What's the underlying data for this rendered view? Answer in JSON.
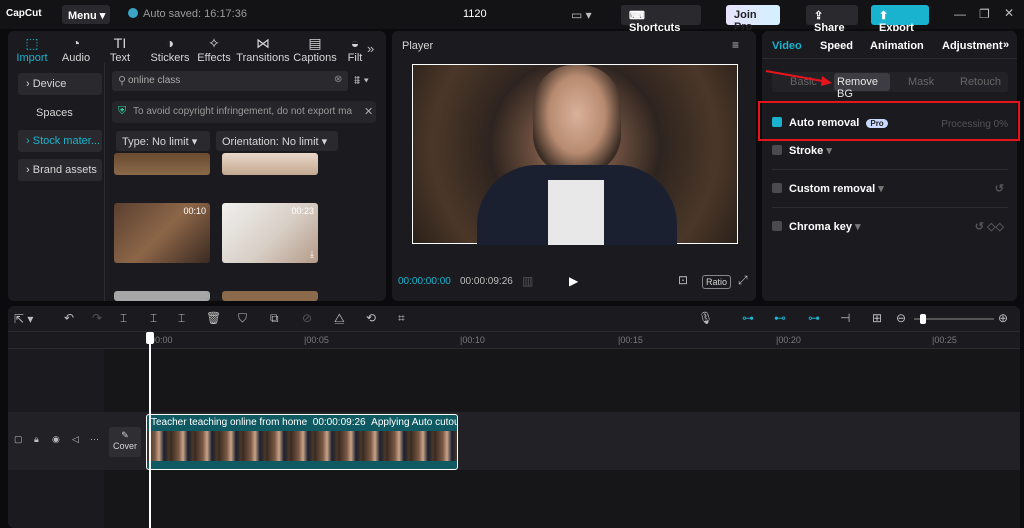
{
  "topbar": {
    "logo": "CapCut",
    "menu": "Menu",
    "autosave": "Auto saved: 16:17:36",
    "project": "1120",
    "shortcuts": "Shortcuts",
    "join_pro": "Join Pro",
    "share": "Share",
    "export": "Export"
  },
  "media_tabs": [
    "Import",
    "Audio",
    "Text",
    "Stickers",
    "Effects",
    "Transitions",
    "Captions",
    "Filt"
  ],
  "media_sidebar": [
    "Device",
    "Spaces",
    "Stock mater...",
    "Brand assets"
  ],
  "search": {
    "placeholder": "online class"
  },
  "notice": "To avoid copyright infringement, do not export ma",
  "filters": {
    "type": "Type: No limit",
    "orientation": "Orientation: No limit"
  },
  "thumbs": [
    "00:10",
    "00:23",
    "",
    ""
  ],
  "player": {
    "title": "Player",
    "current_time": "00:00:00:00",
    "duration": "00:00:09:26",
    "ratio": "Ratio"
  },
  "right_tabs": [
    "Video",
    "Speed",
    "Animation",
    "Adjustment"
  ],
  "sub_tabs": [
    "Basic",
    "Remove BG",
    "Mask",
    "Retouch"
  ],
  "options": {
    "auto_removal": "Auto removal",
    "pro": "Pro",
    "processing": "Processing 0%",
    "stroke": "Stroke",
    "custom_removal": "Custom removal",
    "chroma_key": "Chroma key"
  },
  "ruler": [
    "00:00",
    "|00:05",
    "|00:10",
    "|00:15",
    "|00:20",
    "|00:25"
  ],
  "clip": {
    "name": "Teacher teaching online from home",
    "duration": "00:00:09:26",
    "status": "Applying Auto cutout..."
  },
  "cover": "Cover"
}
